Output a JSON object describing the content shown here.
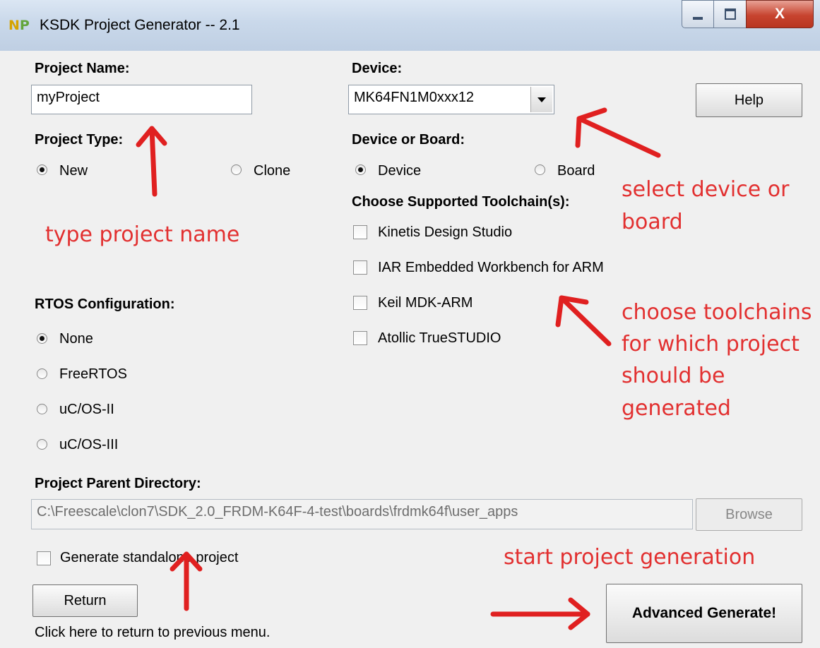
{
  "window": {
    "icon_text": "NP",
    "title": "KSDK Project Generator -- 2.1",
    "minimize_icon": "minimize-icon",
    "maximize_icon": "maximize-icon",
    "close_label": "X"
  },
  "project_name": {
    "label": "Project Name:",
    "value": "myProject"
  },
  "device": {
    "label": "Device:",
    "selected": "MK64FN1M0xxx12"
  },
  "help_label": "Help",
  "project_type": {
    "label": "Project Type:",
    "options": [
      "New",
      "Clone"
    ],
    "selected": "New"
  },
  "device_or_board": {
    "label": "Device or Board:",
    "options": [
      "Device",
      "Board"
    ],
    "selected": "Device"
  },
  "toolchains": {
    "label": "Choose Supported Toolchain(s):",
    "items": [
      "Kinetis Design Studio",
      "IAR Embedded Workbench for ARM",
      "Keil MDK-ARM",
      "Atollic TrueSTUDIO"
    ]
  },
  "rtos": {
    "label": "RTOS Configuration:",
    "options": [
      "None",
      "FreeRTOS",
      "uC/OS-II",
      "uC/OS-III"
    ],
    "selected": "None"
  },
  "parent_dir": {
    "label": "Project Parent Directory:",
    "value": "C:\\Freescale\\clon7\\SDK_2.0_FRDM-K64F-4-test\\boards\\frdmk64f\\user_apps",
    "browse_label": "Browse"
  },
  "standalone_label": "Generate standalone project",
  "return_label": "Return",
  "return_hint": "Click here to return to previous menu.",
  "generate_label": "Advanced Generate!",
  "annotations": {
    "type_name": "type project name",
    "select_device_1": "select device or",
    "select_device_2": "board",
    "toolchains_1": "choose toolchains",
    "toolchains_2": "for which project",
    "toolchains_3": "should be",
    "toolchains_4": "generated",
    "start": "start project generation"
  },
  "colors": {
    "annotation": "#e23030",
    "titlebar": "#c9d8ea",
    "client": "#f0f0f0"
  }
}
